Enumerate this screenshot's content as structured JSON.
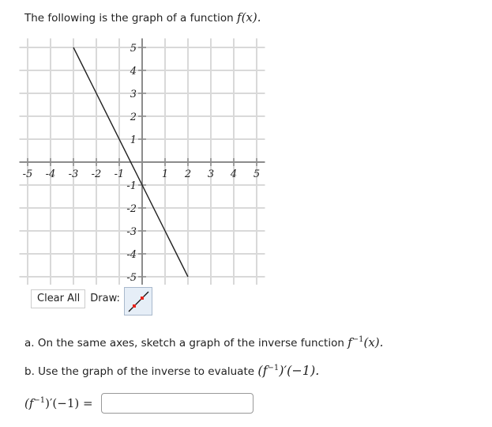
{
  "intro": {
    "text": "The following is the graph of a function ",
    "func": "f(x)."
  },
  "chart_data": {
    "type": "line",
    "title": "",
    "xlabel": "",
    "ylabel": "",
    "xlim": [
      -5,
      5
    ],
    "ylim": [
      -5,
      5
    ],
    "grid": true,
    "x_ticks": [
      "-5",
      "-4",
      "-3",
      "-2",
      "-1",
      "1",
      "2",
      "3",
      "4",
      "5"
    ],
    "y_ticks": [
      "5",
      "4",
      "3",
      "2",
      "1",
      "-1",
      "-2",
      "-3",
      "-4",
      "-5"
    ],
    "series": [
      {
        "name": "f(x)",
        "equation": "y = -2x - 1",
        "points": [
          [
            -3,
            5
          ],
          [
            2,
            -5
          ]
        ]
      }
    ]
  },
  "toolbar": {
    "clear_label": "Clear All",
    "draw_label": "Draw:",
    "tool": "line-segment-tool"
  },
  "questions": {
    "a_text": "a. On the same axes, sketch a graph of the inverse function ",
    "a_math_f": "f",
    "a_math_sup": "−1",
    "a_math_tail": "(x).",
    "b_text": "b. Use the graph of the inverse to evaluate ",
    "b_math_open": "(f",
    "b_math_sup": "−1",
    "b_math_tail": ")′(−1)."
  },
  "answer": {
    "label_open": "(f",
    "label_sup": "−1",
    "label_tail": ")′(−1) =",
    "value": "",
    "placeholder": ""
  },
  "colors": {
    "grid": "#d9d9d9",
    "axis": "#8c8c8c",
    "curve": "#222222",
    "tool_bg": "#e6eef7",
    "tool_point": "#e8231a"
  }
}
